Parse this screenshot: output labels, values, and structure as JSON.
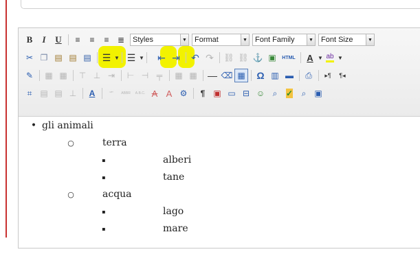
{
  "toolbar": {
    "styles_label": "Styles",
    "format_label": "Format",
    "font_family_label": "Font Family",
    "font_size_label": "Font Size",
    "bold_label": "B",
    "italic_label": "I",
    "underline_label": "U",
    "html_label": "HTML",
    "font_color_label": "A",
    "highlight_label": "ab",
    "omega_label": "Ω",
    "help_label": "A",
    "cite_label": "ABBR",
    "acronym_label": "A.B.C."
  },
  "content": {
    "items": [
      {
        "level": 1,
        "bullet": "•",
        "text": "gli animali"
      },
      {
        "level": 2,
        "bullet": "○",
        "text": "terra"
      },
      {
        "level": 3,
        "bullet": "▪",
        "text": "alberi"
      },
      {
        "level": 3,
        "bullet": "▪",
        "text": "tane"
      },
      {
        "level": 2,
        "bullet": "○",
        "text": "acqua"
      },
      {
        "level": 3,
        "bullet": "▪",
        "text": "lago"
      },
      {
        "level": 3,
        "bullet": "▪",
        "text": "mare"
      }
    ]
  },
  "colors": {
    "highlight": "#f2f200",
    "left_rule": "#c8302f"
  }
}
